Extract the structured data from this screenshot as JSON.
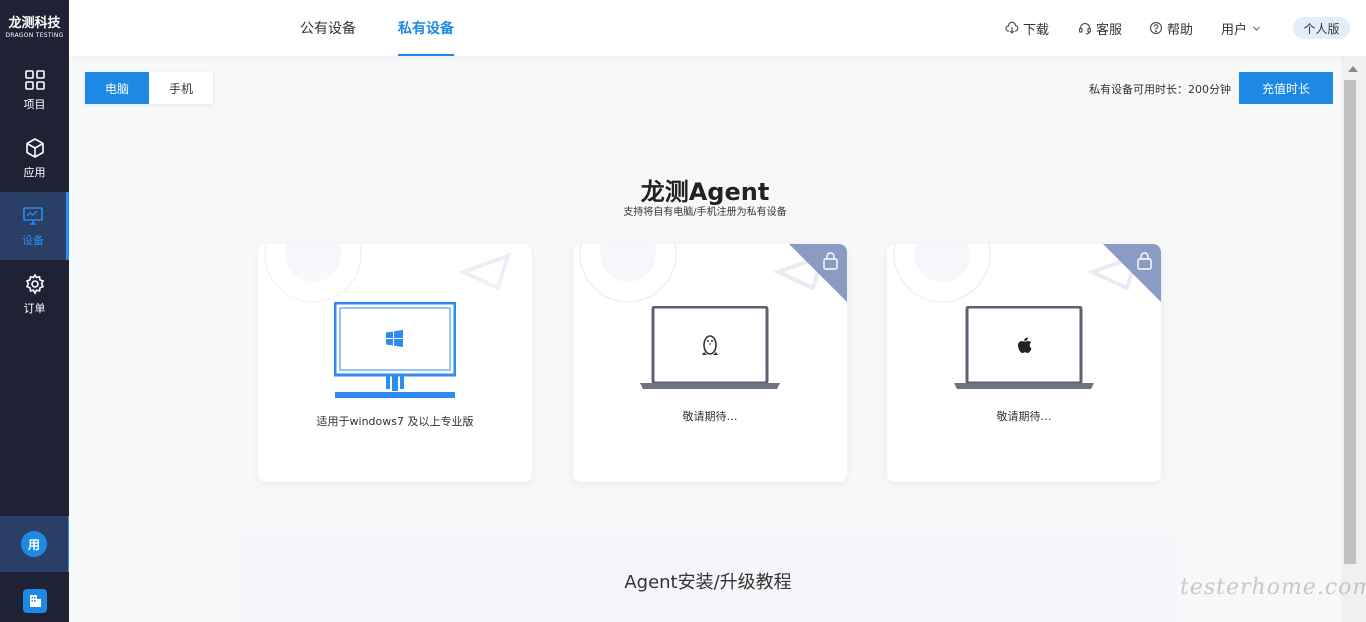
{
  "logo": {
    "cn": "龙测科技",
    "en": "DRAGON TESTING"
  },
  "sidebar": {
    "items": [
      {
        "label": "项目",
        "icon": "grid-icon"
      },
      {
        "label": "应用",
        "icon": "cube-icon"
      },
      {
        "label": "设备",
        "icon": "monitor-icon",
        "active": true
      },
      {
        "label": "订单",
        "icon": "gear-icon"
      }
    ],
    "avatar": "用",
    "building_icon": "building-icon"
  },
  "header": {
    "tabs": [
      {
        "label": "公有设备",
        "active": false
      },
      {
        "label": "私有设备",
        "active": true
      }
    ],
    "download": "下载",
    "service": "客服",
    "help": "帮助",
    "user": "用户",
    "edition": "个人版"
  },
  "main": {
    "segment": [
      {
        "label": "电脑",
        "active": true
      },
      {
        "label": "手机",
        "active": false
      }
    ],
    "remaining_time": "私有设备可用时长：200分钟",
    "recharge_label": "充值时长",
    "agent_title": "龙测Agent",
    "agent_subtitle": "支持将自有电脑/手机注册为私有设备",
    "cards": [
      {
        "os": "windows",
        "caption": "适用于windows7 及以上专业版",
        "locked": false
      },
      {
        "os": "linux",
        "caption": "敬请期待…",
        "locked": true
      },
      {
        "os": "mac",
        "caption": "敬请期待…",
        "locked": true
      }
    ],
    "tutorial_title": "Agent安装/升级教程"
  },
  "watermark": "testerhome.com",
  "colors": {
    "primary": "#1e88e5",
    "sidebar": "#1f2235",
    "sidebar_active": "#2a3f66"
  }
}
